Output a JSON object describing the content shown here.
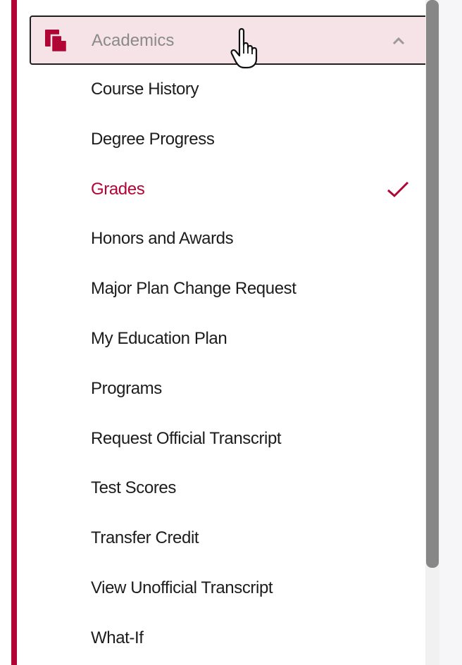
{
  "colors": {
    "accent": "#b10536",
    "header_bg": "#f6e3e7",
    "text": "#1c1c1c",
    "header_text": "#8a8a8a",
    "scrollbar_thumb": "#878787"
  },
  "accordion": {
    "label": "Academics",
    "icon": "documents-icon",
    "expanded_icon": "chevron-up-icon"
  },
  "menu": {
    "items": [
      {
        "label": "Course History",
        "active": false
      },
      {
        "label": "Degree Progress",
        "active": false
      },
      {
        "label": "Grades",
        "active": true
      },
      {
        "label": "Honors and Awards",
        "active": false
      },
      {
        "label": "Major Plan Change Request",
        "active": false
      },
      {
        "label": "My Education Plan",
        "active": false
      },
      {
        "label": "Programs",
        "active": false
      },
      {
        "label": "Request Official Transcript",
        "active": false
      },
      {
        "label": "Test Scores",
        "active": false
      },
      {
        "label": "Transfer Credit",
        "active": false
      },
      {
        "label": "View Unofficial Transcript",
        "active": false
      },
      {
        "label": "What-If",
        "active": false
      }
    ],
    "selected_icon": "checkmark-icon"
  },
  "cursor": "hand-pointer-icon"
}
